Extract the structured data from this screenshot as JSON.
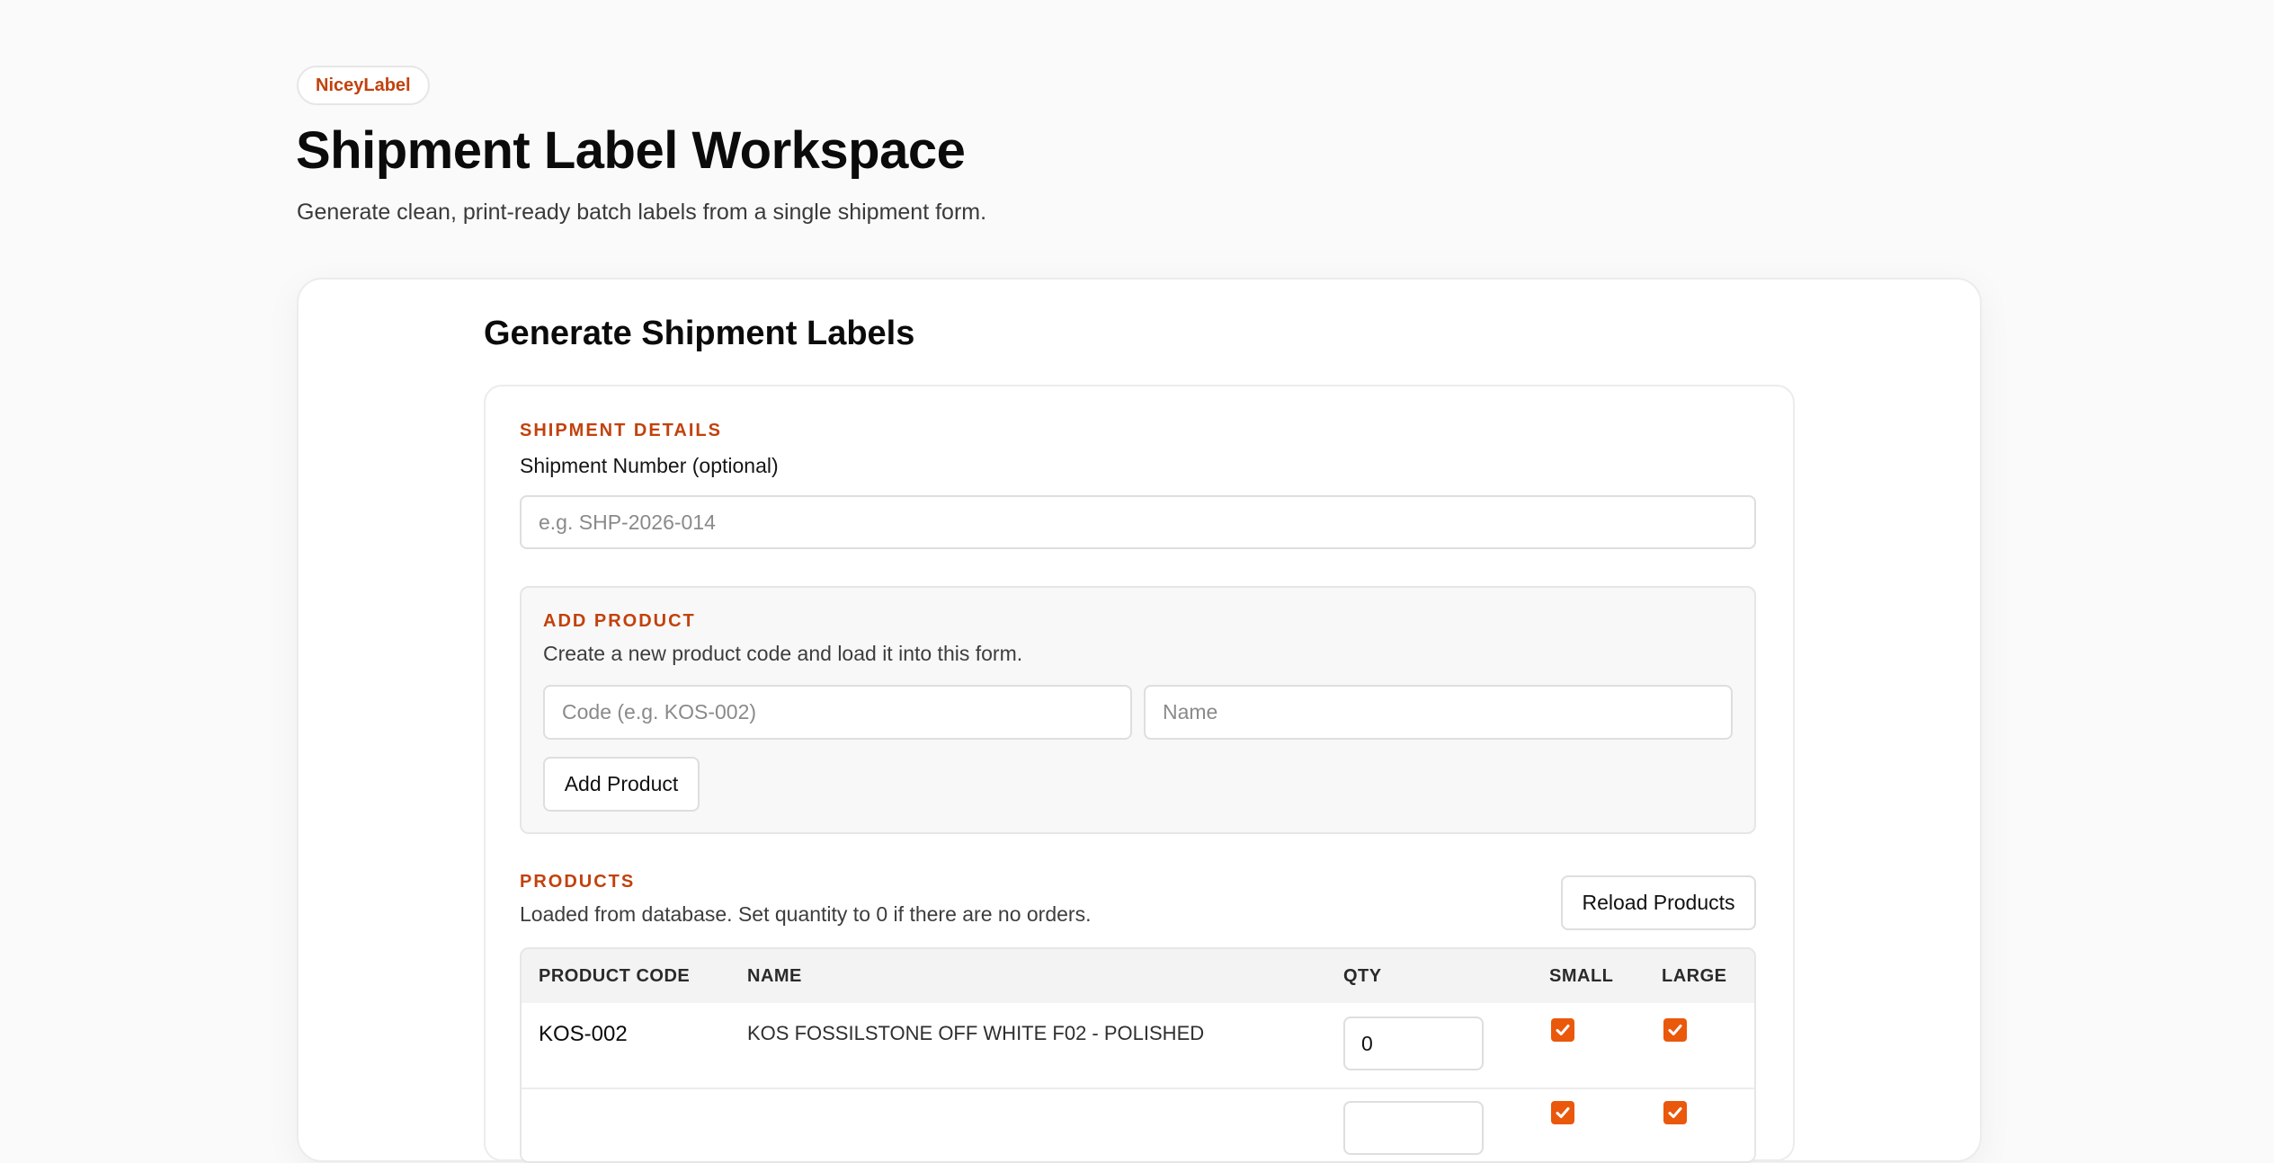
{
  "brand": {
    "name": "NiceyLabel"
  },
  "header": {
    "title": "Shipment Label Workspace",
    "subtitle": "Generate clean, print-ready batch labels from a single shipment form."
  },
  "card": {
    "title": "Generate Shipment Labels"
  },
  "shipment_details": {
    "section_label": "SHIPMENT DETAILS",
    "field_label": "Shipment Number (optional)",
    "placeholder": "e.g. SHP-2026-014",
    "value": ""
  },
  "add_product": {
    "section_label": "ADD PRODUCT",
    "helper": "Create a new product code and load it into this form.",
    "code_placeholder": "Code (e.g. KOS-002)",
    "name_placeholder": "Name",
    "button_label": "Add Product"
  },
  "products": {
    "section_label": "PRODUCTS",
    "helper": "Loaded from database. Set quantity to 0 if there are no orders.",
    "reload_label": "Reload Products",
    "columns": [
      "PRODUCT CODE",
      "NAME",
      "QTY",
      "SMALL",
      "LARGE"
    ],
    "rows": [
      {
        "code": "KOS-002",
        "name": "KOS FOSSILSTONE OFF WHITE F02 - POLISHED",
        "qty": "0",
        "small": true,
        "large": true
      },
      {
        "code": "",
        "name": "",
        "qty": "",
        "small": true,
        "large": true
      }
    ]
  },
  "colors": {
    "accent": "#c2410c",
    "checkbox": "#ea580c"
  },
  "icons": {
    "checkbox": "check-icon"
  }
}
